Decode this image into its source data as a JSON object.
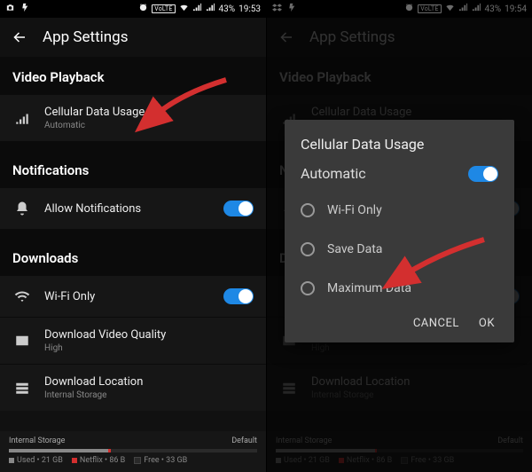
{
  "statusbar": {
    "battery": "43%",
    "time_left": "19:53",
    "time_right": "19:54",
    "volte": "VoLTE"
  },
  "appbar": {
    "title": "App Settings"
  },
  "sections": {
    "video": {
      "header": "Video Playback",
      "cellular_label": "Cellular Data Usage",
      "cellular_sub": "Automatic"
    },
    "notifications": {
      "header": "Notifications",
      "allow_label": "Allow Notifications"
    },
    "downloads": {
      "header": "Downloads",
      "wifi_label": "Wi-Fi Only",
      "quality_label": "Download Video Quality",
      "quality_sub": "High",
      "location_label": "Download Location",
      "location_sub": "Internal Storage"
    }
  },
  "storage": {
    "name": "Internal Storage",
    "default": "Default",
    "used": "Used • 21 GB",
    "netflix": "Netflix • 86 B",
    "free": "Free • 33 GB"
  },
  "dialog": {
    "title": "Cellular Data Usage",
    "automatic": "Automatic",
    "options": [
      "Wi-Fi Only",
      "Save Data",
      "Maximum Data"
    ],
    "cancel": "CANCEL",
    "ok": "OK"
  }
}
